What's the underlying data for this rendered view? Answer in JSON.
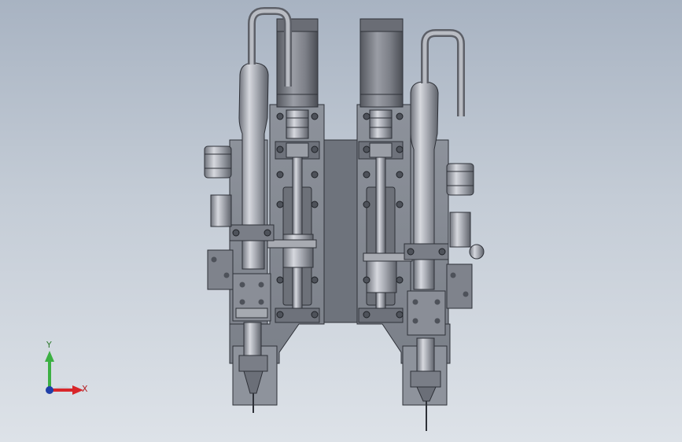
{
  "triad": {
    "y_label": "Y",
    "x_label": "X",
    "y_color": "#3cb043",
    "x_color": "#d8262a",
    "z_color": "#1f3fa8"
  },
  "colors": {
    "background_top": "#a8b3c2",
    "background_bottom": "#dde2e8",
    "plate": "#8a8f98",
    "plate_dark": "#5d626b",
    "metal_light": "#c9ccd3",
    "metal_mid": "#9ea2aa",
    "outline": "#2e3138"
  }
}
